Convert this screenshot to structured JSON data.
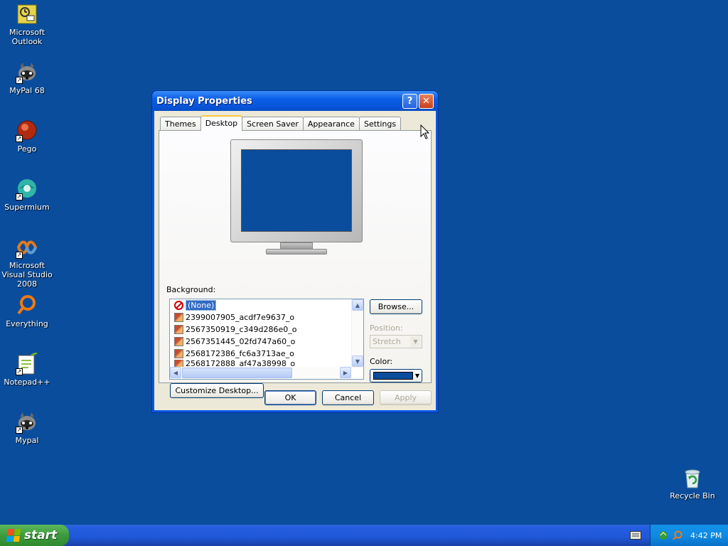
{
  "desktop": {
    "icons": [
      {
        "label": "Microsoft Outlook",
        "icon": "outlook-icon"
      },
      {
        "label": "MyPal 68",
        "icon": "raccoon-icon"
      },
      {
        "label": "Pego",
        "icon": "pego-icon"
      },
      {
        "label": "Supermium",
        "icon": "supermium-icon"
      },
      {
        "label": "Microsoft Visual Studio 2008",
        "icon": "visual-studio-icon"
      },
      {
        "label": "Everything",
        "icon": "search-icon"
      },
      {
        "label": "Notepad++",
        "icon": "notepad-icon"
      },
      {
        "label": "Mypal",
        "icon": "raccoon-icon"
      },
      {
        "label": "Recycle Bin",
        "icon": "recycle-bin-icon"
      }
    ],
    "background_color": "#0a4d9c"
  },
  "dialog": {
    "title": "Display Properties",
    "help_glyph": "?",
    "close_glyph": "✕",
    "tabs": [
      "Themes",
      "Desktop",
      "Screen Saver",
      "Appearance",
      "Settings"
    ],
    "active_tab": "Desktop",
    "background_label": "Background:",
    "background_items": [
      "(None)",
      "2399007905_acdf7e9637_o",
      "2567350919_c349d286e0_o",
      "2567351445_02fd747a60_o",
      "2568172386_fc6a3713ae_o",
      "2568172888_af47a38998_o"
    ],
    "selected_background": "(None)",
    "browse_button": "Browse...",
    "position_label": "Position:",
    "position_value": "Stretch",
    "color_label": "Color:",
    "color_value": "#0a4d9c",
    "customize_button": "Customize Desktop...",
    "ok_button": "OK",
    "cancel_button": "Cancel",
    "apply_button": "Apply"
  },
  "taskbar": {
    "start_label": "start",
    "clock": "4:42 PM"
  }
}
